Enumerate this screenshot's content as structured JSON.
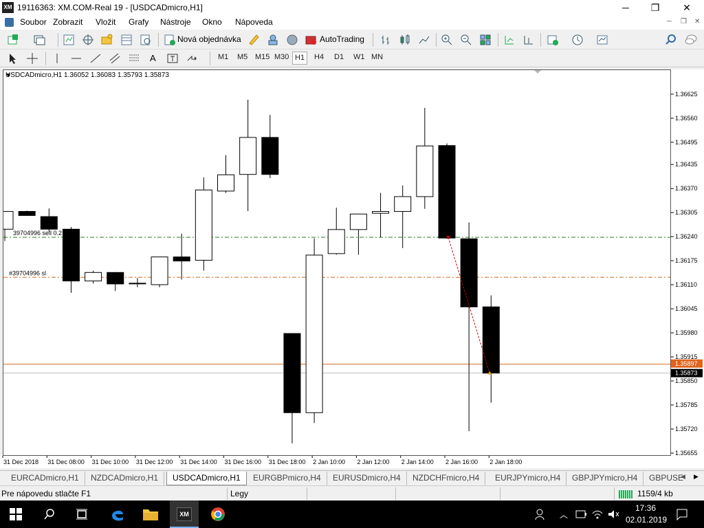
{
  "window": {
    "title": "19116363: XM.COM-Real 19 - [USDCADmicro,H1]",
    "app_badge": "XM",
    "min_glyph": "─",
    "max_glyph": "❐",
    "close_glyph": "✕"
  },
  "menu": {
    "items": [
      "Soubor",
      "Zobrazit",
      "Vložit",
      "Grafy",
      "Nástroje",
      "Okno",
      "Nápoveda"
    ]
  },
  "toolbar": {
    "new_order_label": "Nová objednávka",
    "autotrading_label": "AutoTrading"
  },
  "timeframes": [
    "M1",
    "M5",
    "M15",
    "M30",
    "H1",
    "H4",
    "D1",
    "W1",
    "MN"
  ],
  "active_timeframe": "H1",
  "chart": {
    "symbol_info": "USDCADmicro,H1  1.36052 1.36083 1.35793 1.35873",
    "order_label_sell": "39704996 sell 0.2",
    "order_label_sl": "#39704996 sl",
    "price_tag_bid": "1.35897",
    "price_tag_current": "1.35873"
  },
  "chart_data": {
    "type": "candlestick",
    "y_ticks": [
      "1.36625",
      "1.36560",
      "1.36495",
      "1.36435",
      "1.36370",
      "1.36305",
      "1.36240",
      "1.36175",
      "1.36110",
      "1.36045",
      "1.35980",
      "1.35915",
      "1.35850",
      "1.35785",
      "1.35720",
      "1.35655"
    ],
    "x_ticks": [
      "31 Dec 2018",
      "31 Dec 08:00",
      "31 Dec 10:00",
      "31 Dec 12:00",
      "31 Dec 14:00",
      "31 Dec 16:00",
      "31 Dec 18:00",
      "2 Jan 10:00",
      "2 Jan 12:00",
      "2 Jan 14:00",
      "2 Jan 16:00",
      "2 Jan 18:00"
    ],
    "ylim": [
      1.35655,
      1.36625
    ],
    "order_lines": {
      "sell_entry": 1.3624,
      "stop_loss": 1.36132
    },
    "bid_line": 1.35897,
    "last_price": 1.35873,
    "candles": [
      {
        "o": 1.36262,
        "h": 1.3631,
        "l": 1.3623,
        "c": 1.3631
      },
      {
        "o": 1.3631,
        "h": 1.36312,
        "l": 1.36302,
        "c": 1.36299
      },
      {
        "o": 1.36296,
        "h": 1.36318,
        "l": 1.36255,
        "c": 1.36262
      },
      {
        "o": 1.36262,
        "h": 1.36268,
        "l": 1.3609,
        "c": 1.36122
      },
      {
        "o": 1.36122,
        "h": 1.3615,
        "l": 1.36115,
        "c": 1.36145
      },
      {
        "o": 1.36145,
        "h": 1.36146,
        "l": 1.36095,
        "c": 1.36114
      },
      {
        "o": 1.36116,
        "h": 1.3613,
        "l": 1.36105,
        "c": 1.36116
      },
      {
        "o": 1.36112,
        "h": 1.36187,
        "l": 1.36105,
        "c": 1.36187
      },
      {
        "o": 1.36187,
        "h": 1.3625,
        "l": 1.36126,
        "c": 1.36176
      },
      {
        "o": 1.36178,
        "h": 1.36402,
        "l": 1.3615,
        "c": 1.36368
      },
      {
        "o": 1.36365,
        "h": 1.36462,
        "l": 1.3636,
        "c": 1.36409
      },
      {
        "o": 1.3641,
        "h": 1.36612,
        "l": 1.36311,
        "c": 1.3651
      },
      {
        "o": 1.3651,
        "h": 1.36571,
        "l": 1.364,
        "c": 1.3641
      },
      {
        "o": 1.3598,
        "h": 1.3598,
        "l": 1.35683,
        "c": 1.35766
      },
      {
        "o": 1.35766,
        "h": 1.36237,
        "l": 1.35738,
        "c": 1.36192
      },
      {
        "o": 1.36196,
        "h": 1.3632,
        "l": 1.36193,
        "c": 1.36261
      },
      {
        "o": 1.36261,
        "h": 1.36301,
        "l": 1.36193,
        "c": 1.36303
      },
      {
        "o": 1.36305,
        "h": 1.3636,
        "l": 1.3624,
        "c": 1.3631
      },
      {
        "o": 1.3631,
        "h": 1.3638,
        "l": 1.36211,
        "c": 1.3635
      },
      {
        "o": 1.3635,
        "h": 1.3659,
        "l": 1.36317,
        "c": 1.36487
      },
      {
        "o": 1.36488,
        "h": 1.36494,
        "l": 1.36236,
        "c": 1.36238
      },
      {
        "o": 1.36236,
        "h": 1.3628,
        "l": 1.35716,
        "c": 1.36052
      },
      {
        "o": 1.36052,
        "h": 1.36083,
        "l": 1.35793,
        "c": 1.35873
      }
    ]
  },
  "tabs": [
    "EURCADmicro,H1",
    "NZDCADmicro,H1",
    "USDCADmicro,H1",
    "EURGBPmicro,H4",
    "EURUSDmicro,H4",
    "NZDCHFmicro,H4",
    "EURJPYmicro,H4",
    "GBPJPYmicro,H4",
    "GBPUSE"
  ],
  "active_tab": "USDCADmicro,H1",
  "status": {
    "help_text": "Pre nápovedu stlačte F1",
    "profile": "Legy",
    "traffic": "1159/4 kb"
  },
  "taskbar": {
    "time": "17:36",
    "date": "02.01.2019",
    "xm_badge": "XM"
  }
}
